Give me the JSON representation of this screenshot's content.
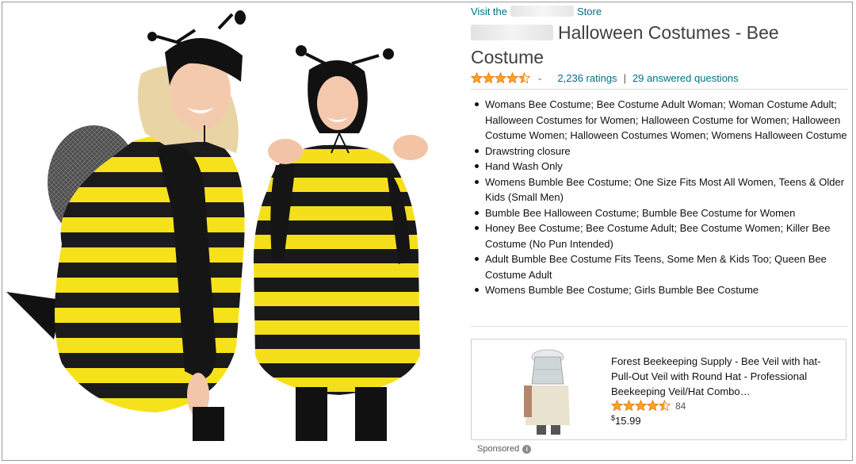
{
  "header": {
    "store_prefix": "Visit the",
    "store_suffix": "Store",
    "title": "Halloween Costumes - Bee Costume"
  },
  "rating": {
    "stars": 4.5,
    "ratings_text": "2,236 ratings",
    "separator": "|",
    "questions_text": "29 answered questions"
  },
  "bullets": [
    "Womans Bee Costume; Bee Costume Adult Woman; Woman Costume Adult; Halloween Costumes for Women; Halloween Costume for Women; Halloween Costume Women; Halloween Costumes Women; Womens Halloween Costume",
    "Drawstring closure",
    "Hand Wash Only",
    "Womens Bumble Bee Costume; One Size Fits Most All Women, Teens & Older Kids (Small Men)",
    "Bumble Bee Halloween Costume; Bumble Bee Costume for Women",
    "Honey Bee Costume; Bee Costume Adult; Bee Costume Women; Killer Bee Costume (No Pun Intended)",
    "Adult Bumble Bee Costume Fits Teens, Some Men & Kids Too; Queen Bee Costume Adult",
    "Womens Bumble Bee Costume; Girls Bumble Bee Costume"
  ],
  "ad": {
    "title": "Forest Beekeeping Supply - Bee Veil with hat- Pull-Out Veil with Round Hat - Professional Beekeeping Veil/Hat Combo…",
    "stars": 4.5,
    "rating_count": "84",
    "price_symbol": "$",
    "price": "15.99",
    "sponsored_label": "Sponsored",
    "info_icon": "i"
  },
  "colors": {
    "link": "#007185",
    "star": "#FFA41C",
    "bee_yellow": "#F6E21A",
    "bee_black": "#1b1b1b"
  },
  "icons": [
    "star-icon",
    "chevron-down-icon",
    "info-icon"
  ]
}
